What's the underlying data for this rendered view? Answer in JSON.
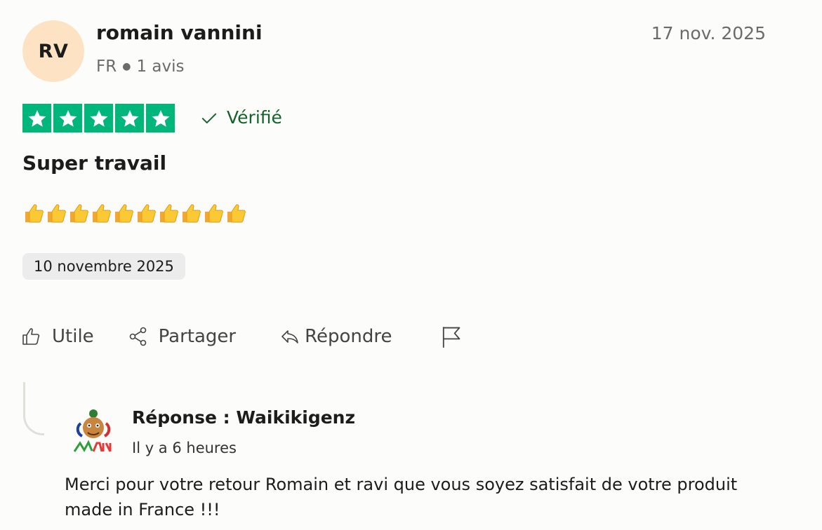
{
  "reviewer": {
    "initials": "RV",
    "name": "romain vannini",
    "country": "FR",
    "review_count": "1 avis",
    "avatar_color": "#fde3c4"
  },
  "review": {
    "date": "17 nov. 2025",
    "rating": 5,
    "max_rating": 5,
    "star_color": "#00b67a",
    "verified_label": "Vérifié",
    "title": "Super travail",
    "body_emoji": "👍👍👍👍👍👍👍👍👍👍",
    "experience_date": "10 novembre 2025"
  },
  "actions": {
    "useful": "Utile",
    "share": "Partager",
    "reply": "Répondre",
    "report_icon": "flag-icon"
  },
  "response": {
    "author": "Réponse : Waikikigenz",
    "time": "Il y a 6 heures",
    "text": "Merci pour votre retour Romain et ravi que vous soyez satisfait de votre produit made in France !!!"
  }
}
